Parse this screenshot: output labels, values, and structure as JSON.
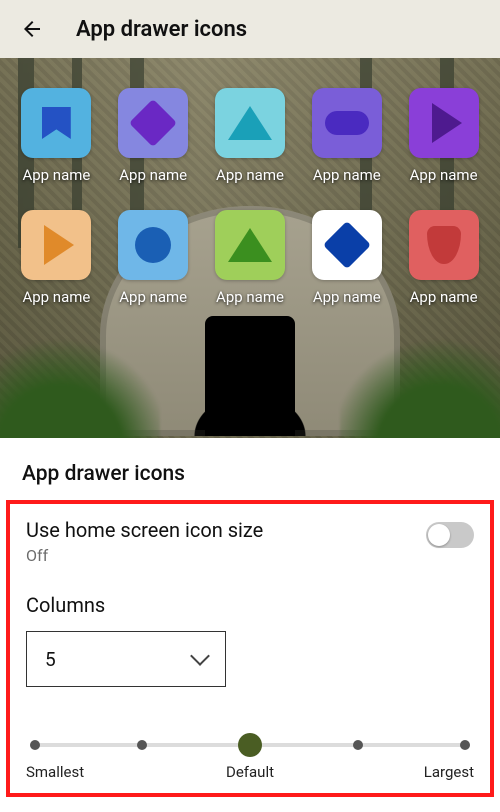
{
  "header": {
    "title": "App drawer icons"
  },
  "preview": {
    "apps": [
      {
        "label": "App name",
        "tile": "#53b2e0",
        "glyph": "bookmark",
        "glyphColor": "#2452c4"
      },
      {
        "label": "App name",
        "tile": "#8587e0",
        "glyph": "diamond",
        "glyphColor": "#6a28c4"
      },
      {
        "label": "App name",
        "tile": "#7bd3e0",
        "glyph": "triangle",
        "glyphColor": "#1aa0b8"
      },
      {
        "label": "App name",
        "tile": "#7a5ed8",
        "glyph": "pill",
        "glyphColor": "#4a2ac0"
      },
      {
        "label": "App name",
        "tile": "#8a3fd8",
        "glyph": "play",
        "glyphColor": "#4e1a8f"
      },
      {
        "label": "App name",
        "tile": "#f2c18a",
        "glyph": "play",
        "glyphColor": "#e08a2a"
      },
      {
        "label": "App name",
        "tile": "#6fb7e8",
        "glyph": "circle",
        "glyphColor": "#1a5fb4"
      },
      {
        "label": "App name",
        "tile": "#9fcf5a",
        "glyph": "triangle",
        "glyphColor": "#3b8f1f"
      },
      {
        "label": "App name",
        "tile": "#ffffff",
        "glyph": "diamond",
        "glyphColor": "#0a3fa8"
      },
      {
        "label": "App name",
        "tile": "#e06060",
        "glyph": "shield",
        "glyphColor": "#c23a3a"
      }
    ]
  },
  "section": {
    "title": "App drawer icons"
  },
  "settings": {
    "use_home_label": "Use home screen icon size",
    "use_home_value": "Off",
    "columns_label": "Columns",
    "columns_value": "5"
  },
  "slider": {
    "ticks": 5,
    "value_index": 2,
    "labels": {
      "min": "Smallest",
      "mid": "Default",
      "max": "Largest"
    }
  }
}
